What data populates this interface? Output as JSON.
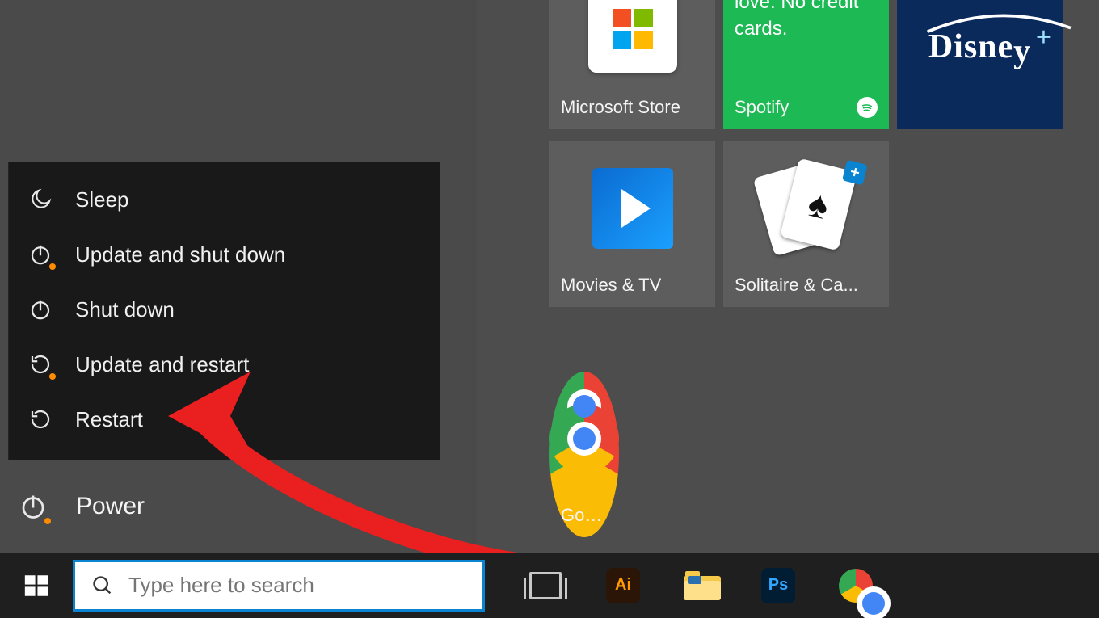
{
  "power_menu": {
    "items": [
      {
        "label": "Sleep",
        "icon": "moon-icon",
        "update": false
      },
      {
        "label": "Update and shut down",
        "icon": "power-icon",
        "update": true
      },
      {
        "label": "Shut down",
        "icon": "power-icon",
        "update": false
      },
      {
        "label": "Update and restart",
        "icon": "restart-icon",
        "update": true
      },
      {
        "label": "Restart",
        "icon": "restart-icon",
        "update": false
      }
    ]
  },
  "power_row": {
    "label": "Power",
    "update": true
  },
  "tiles": {
    "ms_store": {
      "label": "Microsoft Store"
    },
    "spotify": {
      "body": "Play music you love. No credit cards.",
      "label": "Spotify"
    },
    "disney": {
      "label": "Disney+"
    },
    "movies": {
      "label": "Movies & TV"
    },
    "solitaire": {
      "label": "Solitaire & Ca..."
    },
    "chrome": {
      "label": "Google Chrome"
    }
  },
  "search": {
    "placeholder": "Type here to search"
  },
  "taskbar": {
    "icons": [
      "task-view-icon",
      "illustrator-icon",
      "file-explorer-icon",
      "photoshop-icon",
      "chrome-icon"
    ]
  },
  "colors": {
    "accent": "#0a84d0",
    "spotify": "#1db954",
    "arrow": "#ea1f1f"
  }
}
